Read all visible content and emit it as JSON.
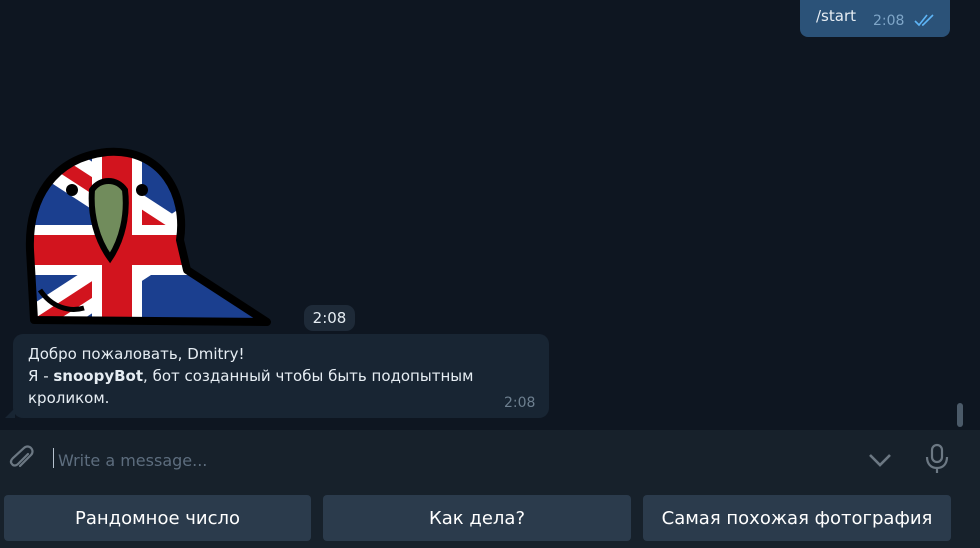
{
  "chat": {
    "outgoing": {
      "text": "/start",
      "time": "2:08"
    },
    "sticker": {
      "time": "2:08",
      "name": "parrot-sticker"
    },
    "incoming": {
      "line1": "Добро пожаловать, Dmitry!",
      "line2_prefix": "Я - ",
      "line2_bold": "snoopyBot",
      "line2_suffix": ", бот созданный чтобы быть подопытным",
      "line3": "кроликом.",
      "time": "2:08"
    }
  },
  "composer": {
    "placeholder": "Write a message...",
    "value": ""
  },
  "keyboard": {
    "buttons": [
      "Рандомное число",
      "Как дела?",
      "Самая похожая фотография"
    ]
  },
  "colors": {
    "background": "#0e1621",
    "outgoing_bubble": "#2b5278",
    "incoming_bubble": "#182533",
    "panel": "#17212b",
    "keyboard_button": "#2b3b4c",
    "accent": "#5eb5f7"
  },
  "icons": [
    "double-check-icon",
    "paperclip-icon",
    "chevron-down-icon",
    "microphone-icon"
  ]
}
